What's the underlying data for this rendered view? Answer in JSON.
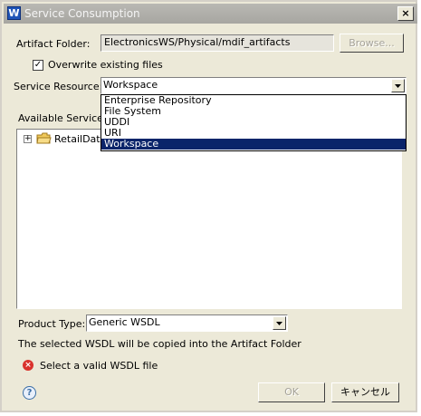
{
  "window": {
    "title": "Service Consumption",
    "close_glyph": "×"
  },
  "artifact_folder": {
    "label": "Artifact Folder:",
    "value": "ElectronicsWS/Physical/mdif_artifacts",
    "browse_label": "Browse..."
  },
  "overwrite": {
    "label": "Overwrite existing files",
    "checked": true
  },
  "service_resource": {
    "label": "Service Resource:",
    "value": "Workspace",
    "options": [
      "Enterprise Repository",
      "File System",
      "UDDI",
      "URI",
      "Workspace"
    ],
    "selected_option": "Workspace"
  },
  "available_services": {
    "label": "Available Services",
    "tree": [
      {
        "label": "RetailData",
        "expanded": false,
        "icon": "folder-icon"
      }
    ]
  },
  "product_type": {
    "label": "Product Type:",
    "value": "Generic WSDL"
  },
  "info_text": "The selected WSDL will be copied into the Artifact Folder",
  "error": {
    "message": "Select a valid WSDL file",
    "icon": "error-icon",
    "color": "#d9322c"
  },
  "buttons": {
    "ok_label": "OK",
    "cancel_label": "キャンセル",
    "help_icon": "help-icon"
  },
  "colors": {
    "selection": "#0a246a",
    "dialog_bg": "#ece9d8"
  }
}
